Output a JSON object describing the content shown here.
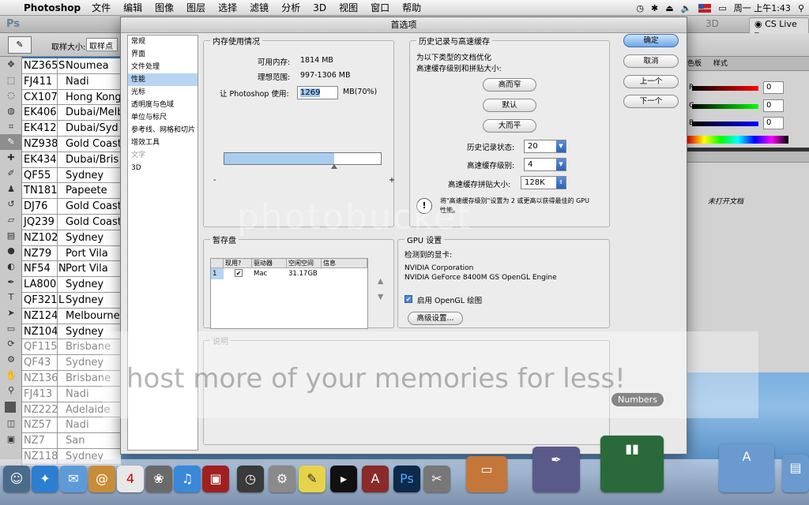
{
  "menubar": {
    "app": "Photoshop",
    "items": [
      "文件",
      "编辑",
      "图像",
      "图层",
      "选择",
      "滤镜",
      "分析",
      "3D",
      "视图",
      "窗口",
      "帮助"
    ],
    "clock": "周一 上午1:43"
  },
  "psbar": {
    "logo": "Ps",
    "threed": "3D",
    "cslive": "CS Live"
  },
  "optbar": {
    "sample_label": "取样大小:",
    "sample_value": "取样点"
  },
  "sheet": {
    "rows": [
      {
        "code": "NZ365",
        "city": "Noumea",
        "sep": "S"
      },
      {
        "code": "FJ411",
        "city": "Nadi",
        "sep": ""
      },
      {
        "code": "CX107",
        "city": "Hong Kong",
        "sep": ""
      },
      {
        "code": "EK406",
        "city": "Dubai/Melb",
        "sep": ""
      },
      {
        "code": "EK412",
        "city": "Dubai/Syd",
        "sep": ""
      },
      {
        "code": "NZ938",
        "city": "Gold Coast",
        "sep": ""
      },
      {
        "code": "EK434",
        "city": "Dubai/Bris",
        "sep": ""
      },
      {
        "code": "QF55",
        "city": "Sydney",
        "sep": ""
      },
      {
        "code": "TN181",
        "city": "Papeete",
        "sep": ""
      },
      {
        "code": "DJ76",
        "city": "Gold Coast",
        "sep": ""
      },
      {
        "code": "JQ239",
        "city": "Gold Coast",
        "sep": ""
      },
      {
        "code": "NZ102",
        "city": "Sydney",
        "sep": ""
      },
      {
        "code": "NZ79",
        "city": "Port Vila",
        "sep": ""
      },
      {
        "code": "NF54",
        "city": "Port Vila",
        "sep": "N"
      },
      {
        "code": "LA800",
        "city": "Sydney",
        "sep": ""
      },
      {
        "code": "QF321",
        "city": "Sydney",
        "sep": "L"
      },
      {
        "code": "NZ124",
        "city": "Melbourne",
        "sep": ""
      },
      {
        "code": "NZ104",
        "city": "Sydney",
        "sep": ""
      },
      {
        "code": "QF115",
        "city": "Brisbane",
        "sep": ""
      },
      {
        "code": "QF43",
        "city": "Sydney",
        "sep": ""
      },
      {
        "code": "NZ136",
        "city": "Brisbane",
        "sep": ""
      },
      {
        "code": "FJ413",
        "city": "Nadi",
        "sep": ""
      },
      {
        "code": "NZ222",
        "city": "Adelaide",
        "sep": ""
      },
      {
        "code": "NZ57",
        "city": "Nadi",
        "sep": ""
      },
      {
        "code": "NZ7",
        "city": "San",
        "sep": ""
      },
      {
        "code": "NZ118",
        "city": "Sydney",
        "sep": ""
      }
    ],
    "dim_from": 18
  },
  "rpanel": {
    "tabs": [
      "色板",
      "样式"
    ],
    "r": "R",
    "g": "G",
    "b": "B",
    "rv": "0",
    "gv": "0",
    "bv": "0",
    "notopen": "未打开文档"
  },
  "dialog": {
    "title": "首选项",
    "categories": [
      {
        "label": "常规",
        "state": ""
      },
      {
        "label": "界面",
        "state": ""
      },
      {
        "label": "文件处理",
        "state": ""
      },
      {
        "label": "性能",
        "state": "sel"
      },
      {
        "label": "光标",
        "state": ""
      },
      {
        "label": "透明度与色域",
        "state": ""
      },
      {
        "label": "单位与标尺",
        "state": ""
      },
      {
        "label": "参考线、网格和切片",
        "state": ""
      },
      {
        "label": "增效工具",
        "state": ""
      },
      {
        "label": "文字",
        "state": "dis"
      },
      {
        "label": "3D",
        "state": ""
      }
    ],
    "memory": {
      "legend": "内存使用情况",
      "available_label": "可用内存:",
      "available": "1814 MB",
      "ideal_label": "理想范围:",
      "ideal": "997-1306 MB",
      "let_label": "让 Photoshop 使用:",
      "let_value": "1269",
      "let_unit": "MB(70%)",
      "minus": "-",
      "plus": "+",
      "fraction": 0.7
    },
    "history": {
      "legend": "历史记录与高速缓存",
      "desc1": "为以下类型的文档优化",
      "desc2": "高速缓存级别和拼贴大小:",
      "btn_tall": "高而窄",
      "btn_default": "默认",
      "btn_wide": "大而平",
      "states_label": "历史记录状态:",
      "states": "20",
      "levels_label": "高速缓存级别:",
      "levels": "4",
      "tile_label": "高速缓存拼贴大小:",
      "tile": "128K",
      "note1": "将\"高速缓存级别\"设置为 2 或更高以获得最佳的 GPU",
      "note2": "性能。"
    },
    "scratch": {
      "legend": "暂存盘",
      "headers": [
        "",
        "现用?",
        "驱动器",
        "空闲空间",
        "信息"
      ],
      "row": {
        "num": "1",
        "drive": "Mac",
        "free": "31.17GB",
        "info": ""
      }
    },
    "gpu": {
      "legend": "GPU 设置",
      "detected": "检测到的显卡:",
      "vendor": "NVIDIA Corporation",
      "card": "NVIDIA GeForce 8400M GS OpenGL Engine",
      "opengl": "启用 OpenGL 绘图",
      "advanced": "高级设置..."
    },
    "desc_legend": "说明",
    "buttons": {
      "ok": "确定",
      "cancel": "取消",
      "prev": "上一个",
      "next": "下一个"
    }
  },
  "dock": {
    "tooltip": "Numbers"
  },
  "watermark": {
    "line1": "photobucket",
    "line2": "host more of your memories for less!"
  }
}
